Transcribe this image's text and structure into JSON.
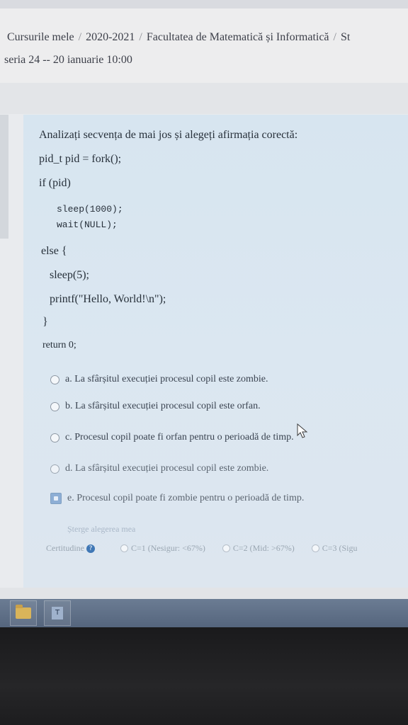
{
  "breadcrumb": {
    "items": [
      "Cursurile mele",
      "2020-2021",
      "Facultatea de Matematică și Informatică",
      "St"
    ],
    "separator": "/"
  },
  "quiz_info": "seria 24 -- 20 ianuarie 10:00",
  "question": {
    "prompt": "Analizați secvența de mai jos și alegeți afirmația corectă:",
    "code_lines": [
      "pid_t pid = fork();",
      "if (pid)",
      "sleep(1000);",
      "wait(NULL);",
      "else {",
      "sleep(5);",
      "printf(\"Hello, World!\\n\");",
      "}",
      "return 0;"
    ]
  },
  "answers": [
    {
      "label": "a. La sfârșitul execuției procesul copil este zombie.",
      "selected": false
    },
    {
      "label": "b. La sfârșitul execuției procesul copil este orfan.",
      "selected": false
    },
    {
      "label": "c. Procesul copil poate fi orfan pentru o perioadă de timp.",
      "selected": false
    },
    {
      "label": "d. La sfârșitul execuției procesul copil este zombie.",
      "selected": false
    },
    {
      "label": "e. Procesul copil poate fi zombie pentru o perioadă de timp.",
      "selected": true
    }
  ],
  "clear_choice": "Șterge alegerea mea",
  "certainty": {
    "label": "Certitudine",
    "options": [
      "C=1 (Nesigur: <67%)",
      "C=2 (Mid: >67%)",
      "C=3 (Sigu"
    ]
  },
  "taskbar": {
    "app_glyph": "T"
  },
  "colors": {
    "question_bg": "#d7e5f0",
    "selected": "#7aa1cf",
    "help_icon": "#3f77b5"
  }
}
